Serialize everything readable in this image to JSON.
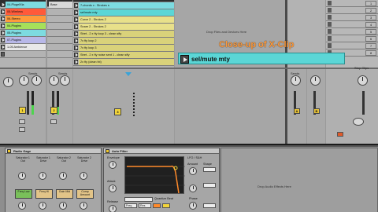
{
  "session": {
    "master_clips": [
      "04-PlugelXla",
      "05-Wireless",
      "06-Stereo",
      "04-Plugins",
      "05-Plugins",
      "07-Plugins",
      "1-05 Ambience"
    ],
    "col2_clips": [
      "Base"
    ],
    "clips": [
      "7-chords x . Strokes s",
      "sel/mute mty",
      "Curve 2 - Strokes 2",
      "Snare 2 - Strokes 2",
      "Stret - 2 x fty loop 3 - clean sfty",
      "7x fty loop 2",
      "7x fty loop 3",
      "Stret - 2 x fty noise sent 1 - clean sfty",
      "2x fty (clean fxt)",
      "2x fty (clean fxt) mix"
    ],
    "drop_text": "Drop Files and Devices Here",
    "scene_numbers": [
      "1",
      "2",
      "3",
      "4",
      "5",
      "6",
      "7",
      "8"
    ],
    "stop_label": "Stop Clips",
    "callout": {
      "title": "Close-up of X-Clip",
      "clip_text": "sel/mute mty"
    }
  },
  "mixer": {
    "sends_label": "Sends",
    "track_numbers": [
      "1",
      "2",
      "3"
    ],
    "ab_labels": [
      "A",
      "B"
    ],
    "post_label": "Post"
  },
  "devices": {
    "rack_title": "Radio Gage",
    "chains": [
      {
        "name": "Saturator 1 Out",
        "sub": "1 Drive"
      },
      {
        "name": "Saturator 1 Drive",
        "sub": "Drive"
      },
      {
        "name": "Saturator 2 Out",
        "sub": "2 Out"
      },
      {
        "name": "Saturator 2 Drive",
        "sub": "Drive"
      }
    ],
    "chain_buttons": [
      "Freq Low",
      "Freq Hi",
      "Gain Mid",
      "Comp Amount"
    ],
    "filter_title": "Auto Filter",
    "filter_labels": {
      "envelope": "Envelope",
      "attack": "Attack",
      "release": "Release",
      "lfo": "LFO / S&H",
      "amount": "Amount",
      "phase": "Phase",
      "shape": "Shape",
      "quantize": "Quantize Beat",
      "freq": "Freq",
      "res": "Res"
    },
    "drop_text": "Drop Audio Effects Here"
  }
}
